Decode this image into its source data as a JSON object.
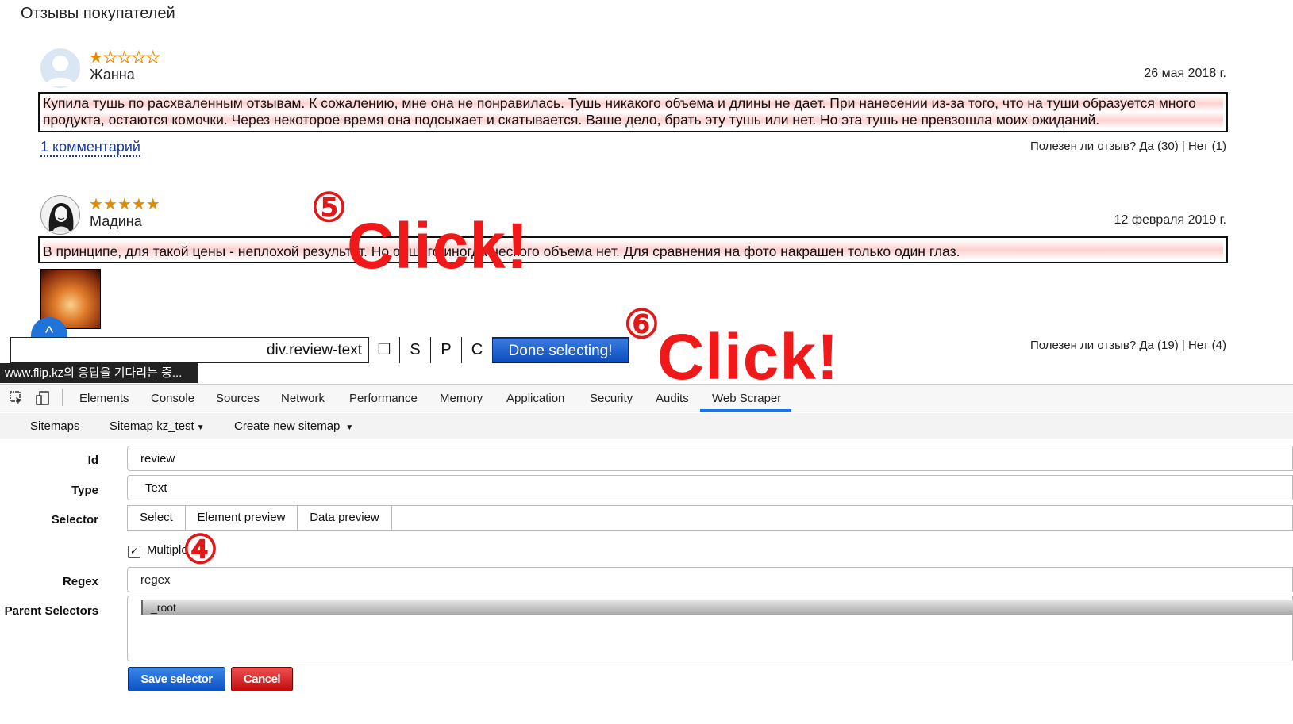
{
  "page": {
    "title": "Отзывы покупателей"
  },
  "reviews": [
    {
      "stars_filled": 1,
      "stars_total": 5,
      "author": "Жанна",
      "date": "26 мая 2018 г.",
      "text_line1": "Купила тушь по расхваленным отзывам. К сожалению, мне она не понравилась. Тушь никакого объема и длины не дает. При нанесении из-за того, что на туши образуется много",
      "text_line2": "продукта, остаются комочки. Через некоторое время она подсыхает и скатывается. Ваше дело, брать эту тушь или нет. Но эта тушь не превзошла моих ожиданий.",
      "comments_link": "1 комментарий",
      "helpful": "Полезен ли отзыв? Да (30) | Нет (1)"
    },
    {
      "stars_filled": 5,
      "stars_total": 5,
      "author": "Мадина",
      "date": "12 февраля 2019 г.",
      "text_line1": "В принципе, для такой цены - неплохой результат. Но общего иногда ческого объема нет. Для сравнения на фото накрашен только один глаз.",
      "helpful": "Полезен ли отзыв? Да (19) | Нет (4)"
    }
  ],
  "annotations": {
    "step4": "④",
    "step5": "⑤",
    "step6": "⑥",
    "click": "Click!"
  },
  "selection_toolbar": {
    "selector": "div.review-text",
    "checkbox_symbol": "☐",
    "btn_s": "S",
    "btn_p": "P",
    "btn_c": "C",
    "done": "Done selecting!"
  },
  "status_tooltip": "www.flip.kz의 응답을 기다리는 중...",
  "devtools": {
    "tabs": [
      "Elements",
      "Console",
      "Sources",
      "Network",
      "Performance",
      "Memory",
      "Application",
      "Security",
      "Audits",
      "Web Scraper"
    ],
    "active_tab": "Web Scraper"
  },
  "sitemap_bar": {
    "sitemaps": "Sitemaps",
    "sitemap_current": "Sitemap kz_test",
    "create_new": "Create new sitemap"
  },
  "form": {
    "id_label": "Id",
    "id_value": "review",
    "type_label": "Type",
    "type_value": "Text",
    "selector_label": "Selector",
    "select_btn": "Select",
    "element_preview_btn": "Element preview",
    "data_preview_btn": "Data preview",
    "multiple_label": "Multiple",
    "multiple_checked": true,
    "regex_label": "Regex",
    "regex_placeholder": "regex",
    "parent_label": "Parent Selectors",
    "parent_option": "_root",
    "save_btn": "Save selector",
    "cancel_btn": "Cancel"
  }
}
